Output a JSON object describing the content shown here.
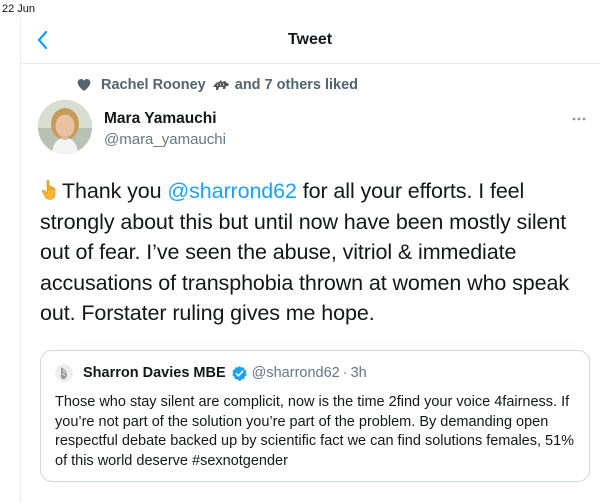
{
  "status_bar": {
    "time": "22 Jun"
  },
  "header": {
    "title": "Tweet",
    "back_icon": "chevron-left-icon"
  },
  "social_context": {
    "icon": "heart-icon",
    "name": "Rachel Rooney",
    "name_emoji": "animal-emoji-icon",
    "rest": "and 7 others liked"
  },
  "author": {
    "name": "Mara Yamauchi",
    "handle": "@mara_yamauchi",
    "avatar": "avatar-photo"
  },
  "tweet": {
    "emoji": "pointing-down-icon",
    "text_before_mention": "Thank you ",
    "mention": "@sharrond62",
    "text_after_mention": " for all your efforts. I feel strongly about this but until now have been mostly silent out of fear. I’ve seen the abuse, vitriol & immediate accusations of transphobia thrown at women who speak out. Forstater ruling gives me hope."
  },
  "quoted_tweet": {
    "name": "Sharron Davies MBE",
    "verified": true,
    "handle": "@sharrond62",
    "separator": "·",
    "time": "3h",
    "text": "Those who stay silent are complicit, now is the time 2find your voice 4fairness. If you’re not part of the solution you’re part of the problem. By demanding open respectful debate backed up by scientific fact we can find solutions females, 51% of this world deserve #sexnotgender"
  },
  "colors": {
    "accent": "#1da1f2",
    "secondary_text": "#657786",
    "border": "#cfd9de"
  }
}
